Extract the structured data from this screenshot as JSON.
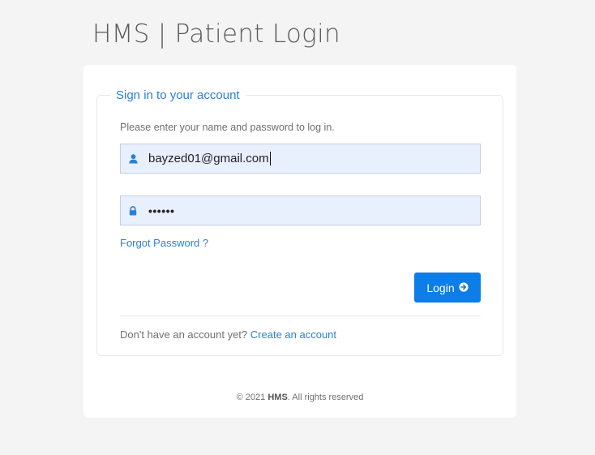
{
  "page_title": "HMS | Patient Login",
  "login_form": {
    "legend": "Sign in to your account",
    "hint": "Please enter your name and password to log in.",
    "email": {
      "value": "bayzed01@gmail.com",
      "icon": "user-icon"
    },
    "password": {
      "value": "••••••",
      "icon": "lock-icon"
    },
    "forgot_password": "Forgot Password ?",
    "login_button": "Login",
    "login_icon": "arrow-circle-right-icon",
    "signup_prompt": "Don't have an account yet?",
    "signup_link": "Create an account"
  },
  "footer": {
    "copyright_prefix": "© 2021",
    "brand": "HMS",
    "suffix": ". All rights reserved"
  },
  "colors": {
    "accent": "#0d7de8",
    "link": "#2b7fd4",
    "input_bg": "#e8effd",
    "page_bg": "#f4f4f4"
  }
}
